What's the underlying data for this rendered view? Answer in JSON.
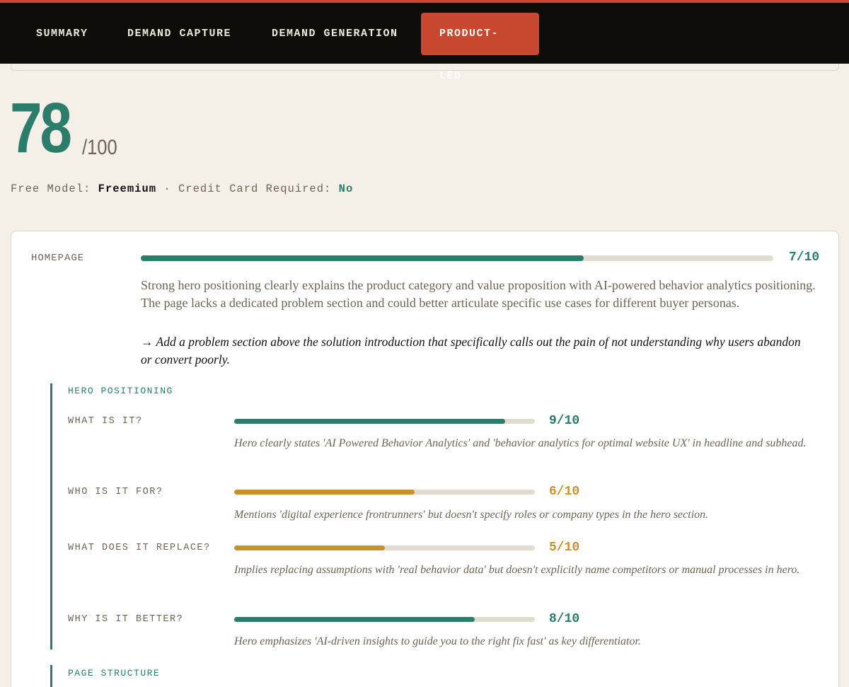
{
  "tabs": [
    {
      "label": "SUMMARY",
      "active": false
    },
    {
      "label": "DEMAND CAPTURE",
      "active": false
    },
    {
      "label": "DEMAND GENERATION",
      "active": false
    },
    {
      "label": "PRODUCT-LED",
      "active": true
    }
  ],
  "overall": {
    "score": "78",
    "max": "/100"
  },
  "model": {
    "free_model_label": "Free Model:",
    "free_model_value": "Freemium",
    "separator": "·",
    "credit_card_label": "Credit Card Required:",
    "credit_card_value": "No"
  },
  "homepage": {
    "label": "HOMEPAGE",
    "score": "7/10",
    "fraction": 0.7,
    "summary": "Strong hero positioning clearly explains the product category and value proposition with AI-powered behavior analytics positioning. The page lacks a dedicated problem section and could better articulate specific use cases for different buyer personas.",
    "recommendation": "→ Add a problem section above the solution introduction that specifically calls out the pain of not understanding why users abandon or convert poorly.",
    "sections": [
      {
        "title": "HERO POSITIONING",
        "items": [
          {
            "label": "WHAT IS IT?",
            "score": "9/10",
            "fraction": 0.9,
            "note": "Hero clearly states 'AI Powered Behavior Analytics' and 'behavior analytics for optimal website UX' in headline and subhead."
          },
          {
            "label": "WHO IS IT FOR?",
            "score": "6/10",
            "fraction": 0.6,
            "note": "Mentions 'digital experience frontrunners' but doesn't specify roles or company types in the hero section."
          },
          {
            "label": "WHAT DOES IT REPLACE?",
            "score": "5/10",
            "fraction": 0.5,
            "note": "Implies replacing assumptions with 'real behavior data' but doesn't explicitly name competitors or manual processes in hero."
          },
          {
            "label": "WHY IS IT BETTER?",
            "score": "8/10",
            "fraction": 0.8,
            "note": "Hero emphasizes 'AI-driven insights to guide you to the right fix fast' as key differentiator."
          }
        ]
      },
      {
        "title": "PAGE STRUCTURE",
        "items": []
      }
    ]
  },
  "colors": {
    "accent": "#c8472f",
    "good": "#2a7c6b",
    "medium": "#c8922a",
    "track": "#e1dccf"
  }
}
